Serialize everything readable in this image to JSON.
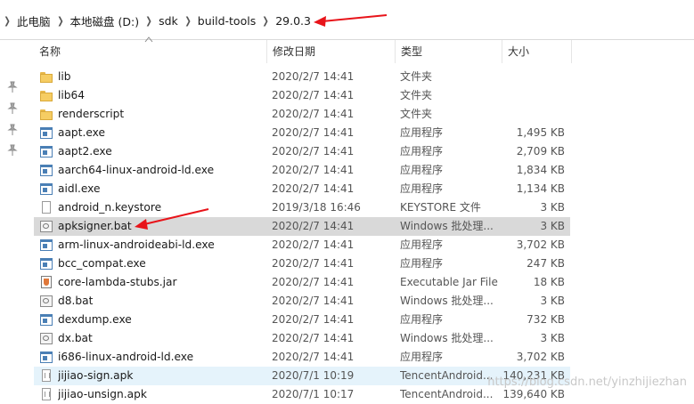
{
  "breadcrumb": {
    "items": [
      {
        "label": "此电脑"
      },
      {
        "label": "本地磁盘 (D:)"
      },
      {
        "label": "sdk"
      },
      {
        "label": "build-tools"
      },
      {
        "label": "29.0.3"
      }
    ]
  },
  "columns": {
    "name": "名称",
    "date": "修改日期",
    "type": "类型",
    "size": "大小"
  },
  "files": [
    {
      "icon": "folder-icon",
      "name": "lib",
      "date": "2020/2/7 14:41",
      "type": "文件夹",
      "size": ""
    },
    {
      "icon": "folder-icon",
      "name": "lib64",
      "date": "2020/2/7 14:41",
      "type": "文件夹",
      "size": ""
    },
    {
      "icon": "folder-icon",
      "name": "renderscript",
      "date": "2020/2/7 14:41",
      "type": "文件夹",
      "size": ""
    },
    {
      "icon": "exe-icon",
      "name": "aapt.exe",
      "date": "2020/2/7 14:41",
      "type": "应用程序",
      "size": "1,495 KB"
    },
    {
      "icon": "exe-icon",
      "name": "aapt2.exe",
      "date": "2020/2/7 14:41",
      "type": "应用程序",
      "size": "2,709 KB"
    },
    {
      "icon": "exe-icon",
      "name": "aarch64-linux-android-ld.exe",
      "date": "2020/2/7 14:41",
      "type": "应用程序",
      "size": "1,834 KB"
    },
    {
      "icon": "exe-icon",
      "name": "aidl.exe",
      "date": "2020/2/7 14:41",
      "type": "应用程序",
      "size": "1,134 KB"
    },
    {
      "icon": "file-icon",
      "name": "android_n.keystore",
      "date": "2019/3/18 16:46",
      "type": "KEYSTORE 文件",
      "size": "3 KB"
    },
    {
      "icon": "bat-icon",
      "name": "apksigner.bat",
      "date": "2020/2/7 14:41",
      "type": "Windows 批处理...",
      "size": "3 KB"
    },
    {
      "icon": "exe-icon",
      "name": "arm-linux-androideabi-ld.exe",
      "date": "2020/2/7 14:41",
      "type": "应用程序",
      "size": "3,702 KB"
    },
    {
      "icon": "exe-icon",
      "name": "bcc_compat.exe",
      "date": "2020/2/7 14:41",
      "type": "应用程序",
      "size": "247 KB"
    },
    {
      "icon": "jar-icon",
      "name": "core-lambda-stubs.jar",
      "date": "2020/2/7 14:41",
      "type": "Executable Jar File",
      "size": "18 KB"
    },
    {
      "icon": "bat-icon",
      "name": "d8.bat",
      "date": "2020/2/7 14:41",
      "type": "Windows 批处理...",
      "size": "3 KB"
    },
    {
      "icon": "exe-icon",
      "name": "dexdump.exe",
      "date": "2020/2/7 14:41",
      "type": "应用程序",
      "size": "732 KB"
    },
    {
      "icon": "bat-icon",
      "name": "dx.bat",
      "date": "2020/2/7 14:41",
      "type": "Windows 批处理...",
      "size": "3 KB"
    },
    {
      "icon": "exe-icon",
      "name": "i686-linux-android-ld.exe",
      "date": "2020/2/7 14:41",
      "type": "应用程序",
      "size": "3,702 KB"
    },
    {
      "icon": "apk-icon",
      "name": "jijiao-sign.apk",
      "date": "2020/7/1 10:19",
      "type": "TencentAndroid...",
      "size": "140,231 KB"
    },
    {
      "icon": "apk-icon",
      "name": "jijiao-unsign.apk",
      "date": "2020/7/1 10:17",
      "type": "TencentAndroid...",
      "size": "139,640 KB"
    }
  ],
  "selected_file": "apksigner.bat",
  "hover_file": "jijiao-sign.apk",
  "watermark": "https://blog.csdn.net/yinzhijiezhan",
  "colors": {
    "arrow": "#e8141a",
    "selected_row": "#d9d9d9",
    "hover_row": "#e5f3fb",
    "folder": "#f6cd63"
  }
}
